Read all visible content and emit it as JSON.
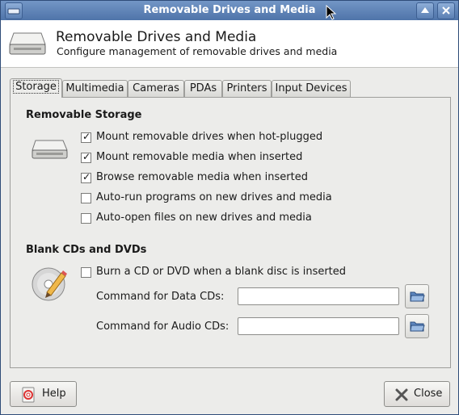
{
  "window": {
    "title": "Removable Drives and Media"
  },
  "header": {
    "title": "Removable Drives and Media",
    "subtitle": "Configure management of removable drives and media",
    "icon": "drive-icon"
  },
  "tabs": [
    {
      "label": "Storage",
      "active": true
    },
    {
      "label": "Multimedia",
      "active": false
    },
    {
      "label": "Cameras",
      "active": false
    },
    {
      "label": "PDAs",
      "active": false
    },
    {
      "label": "Printers",
      "active": false
    },
    {
      "label": "Input Devices",
      "active": false
    }
  ],
  "storage": {
    "section_title": "Removable Storage",
    "options": [
      {
        "label": "Mount removable drives when hot-plugged",
        "checked": true
      },
      {
        "label": "Mount removable media when inserted",
        "checked": true
      },
      {
        "label": "Browse removable media when inserted",
        "checked": true
      },
      {
        "label": "Auto-run programs on new drives and media",
        "checked": false
      },
      {
        "label": "Auto-open files on new drives and media",
        "checked": false
      }
    ]
  },
  "blank_cds": {
    "section_title": "Blank CDs and DVDs",
    "burn_option": {
      "label": "Burn a CD or DVD when a blank disc is inserted",
      "checked": false
    },
    "data_cd": {
      "label": "Command for Data CDs:",
      "value": ""
    },
    "audio_cd": {
      "label": "Command for Audio CDs:",
      "value": ""
    }
  },
  "buttons": {
    "help": "Help",
    "close": "Close"
  }
}
